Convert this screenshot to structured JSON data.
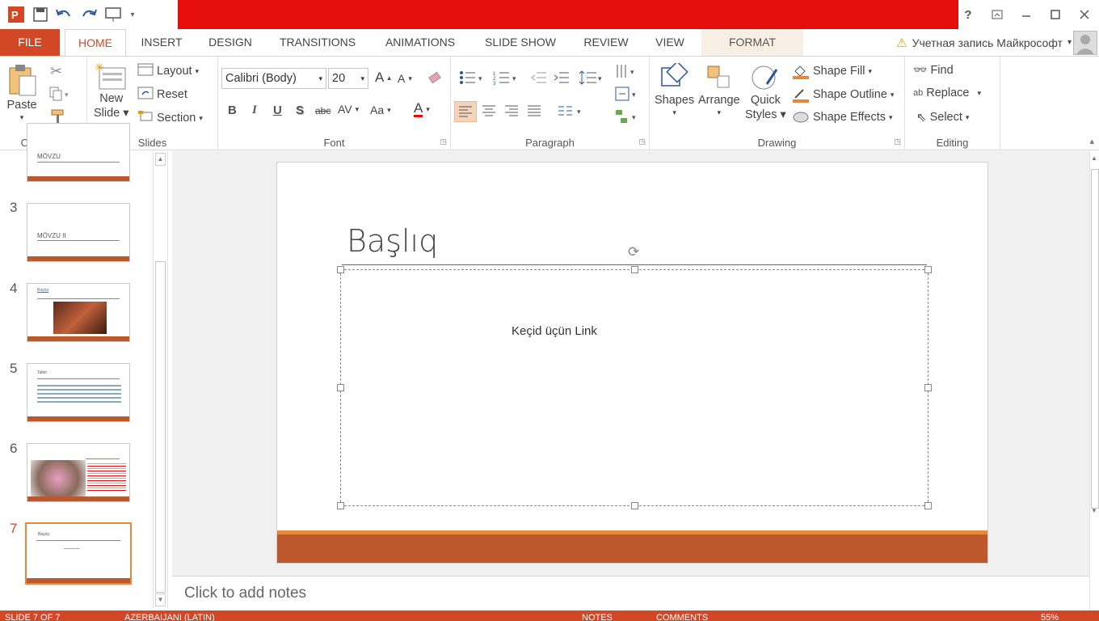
{
  "tabs": {
    "file": "FILE",
    "home": "HOME",
    "insert": "INSERT",
    "design": "DESIGN",
    "transitions": "TRANSITIONS",
    "animations": "ANIMATIONS",
    "slideshow": "SLIDE SHOW",
    "review": "REVIEW",
    "view": "VIEW",
    "format": "FORMAT"
  },
  "account": {
    "warning": "⚠",
    "name": "Учетная запись Майкрософт"
  },
  "title_help": "?",
  "ribbon": {
    "clipboard": {
      "paste": "Paste",
      "label": "Clipboard"
    },
    "slides": {
      "new_slide_1": "New",
      "new_slide_2": "Slide",
      "layout": "Layout",
      "reset": "Reset",
      "section": "Section",
      "label": "Slides"
    },
    "font": {
      "font_name": "Calibri (Body)",
      "font_size": "20",
      "bold": "B",
      "italic": "I",
      "underline": "U",
      "shadow": "S",
      "strike": "abc",
      "spacing": "AV",
      "case": "Aa",
      "color": "A",
      "grow": "A",
      "shrink": "A",
      "label": "Font"
    },
    "paragraph": {
      "label": "Paragraph"
    },
    "drawing": {
      "shapes": "Shapes",
      "arrange": "Arrange",
      "quick_1": "Quick",
      "quick_2": "Styles",
      "fill": "Shape Fill",
      "outline": "Shape Outline",
      "effects": "Shape Effects",
      "label": "Drawing"
    },
    "editing": {
      "find": "Find",
      "replace": "Replace",
      "select": "Select",
      "label": "Editing"
    }
  },
  "thumbnails": [
    {
      "num": "",
      "title": "MÖVZU"
    },
    {
      "num": "3",
      "title": "MÖVZU II"
    },
    {
      "num": "4",
      "title": "Başlıq"
    },
    {
      "num": "5",
      "title": "Tablo"
    },
    {
      "num": "6",
      "title": ""
    },
    {
      "num": "7",
      "title": "Başlıq"
    }
  ],
  "slide": {
    "title": "Başlıq",
    "content": "Keçid üçün Link"
  },
  "notes": "Click to add notes",
  "status": {
    "slide": "SLIDE 7 OF 7",
    "lang": "AZERBAIJANI (LATIN)",
    "notes": "NOTES",
    "comments": "COMMENTS",
    "zoom": "55%"
  },
  "colors": {
    "accent": "#d24726",
    "slide_bar": "#bd582c",
    "slide_stripe": "#e7873a",
    "banner": "#e60d0d"
  }
}
